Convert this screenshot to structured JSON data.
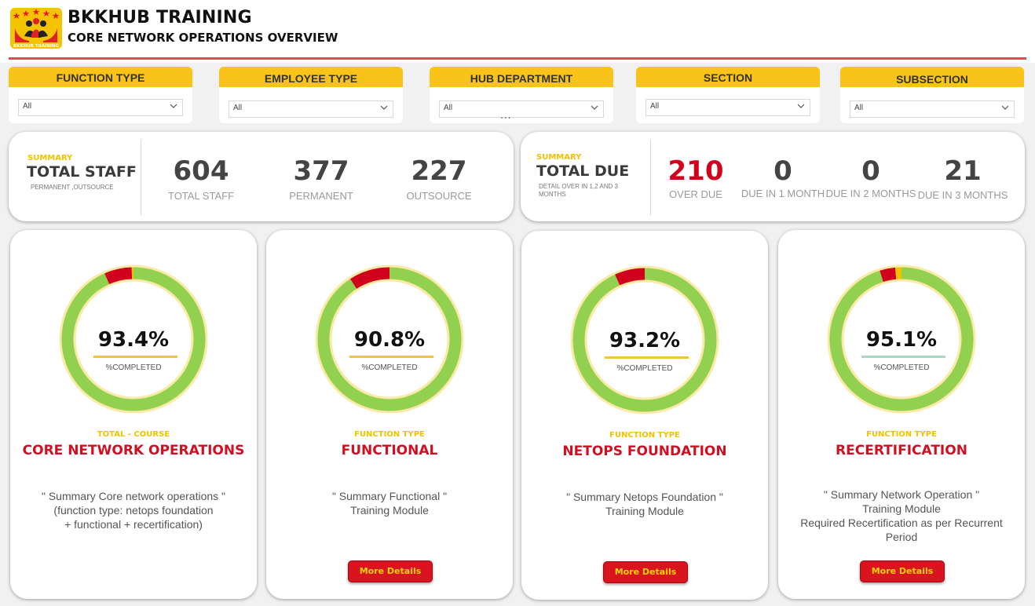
{
  "header": {
    "title": "BKKHUB TRAINING",
    "subtitle": "CORE NETWORK OPERATIONS OVERVIEW",
    "logo_caption": "BKKHUB TRAINING"
  },
  "filters": [
    {
      "label": "FUNCTION TYPE",
      "value": "All"
    },
    {
      "label": "EMPLOYEE TYPE",
      "value": "All"
    },
    {
      "label": "HUB DEPARTMENT",
      "value": "All"
    },
    {
      "label": "SECTION",
      "value": "All"
    },
    {
      "label": "SUBSECTION",
      "value": "All"
    }
  ],
  "more_options": "...",
  "staff_summary": {
    "eyebrow": "SUMMARY",
    "title": "TOTAL STAFF",
    "subtitle": "PERMANENT ,OUTSOURCE",
    "kpis": [
      {
        "value": "604",
        "label": "TOTAL STAFF"
      },
      {
        "value": "377",
        "label": "PERMANENT"
      },
      {
        "value": "227",
        "label": "OUTSOURCE"
      }
    ]
  },
  "due_summary": {
    "eyebrow": "SUMMARY",
    "title": "TOTAL DUE",
    "subtitle": "DETAIL OVER IN 1,2 AND 3 MONTHS",
    "kpis": [
      {
        "value": "210",
        "label": "OVER DUE",
        "color": "#d1001c"
      },
      {
        "value": "0",
        "label": "DUE IN 1 MONTH"
      },
      {
        "value": "0",
        "label": "DUE IN 2 MONTHS"
      },
      {
        "value": "21",
        "label": "DUE IN 3 MONTHS"
      }
    ]
  },
  "colors": {
    "accent_yellow": "#f9c31a",
    "completed_green": "#92d050",
    "overdue_red": "#d1001c",
    "warning_yellow": "#f2c200",
    "button_red": "#d9141f"
  },
  "cards": [
    {
      "percent": "93.4%",
      "caption": "%COMPLETED",
      "eyebrow": "TOTAL - COURSE",
      "name": "CORE NETWORK OPERATIONS",
      "description": "\" Summary Core network operations \"\n(function type: netops foundation\n+ functional + recertification)",
      "button": "",
      "bar_color": "#f5c23a",
      "segments": [
        {
          "fraction": 0.934,
          "color": "#92d050"
        },
        {
          "fraction": 0.062,
          "color": "#d1001c"
        },
        {
          "fraction": 0.004,
          "color": "#f2c200"
        }
      ]
    },
    {
      "percent": "90.8%",
      "caption": "%COMPLETED",
      "eyebrow": "FUNCTION TYPE",
      "name": "FUNCTIONAL",
      "description": "\" Summary Functional \"\nTraining Module",
      "button": "More Details",
      "bar_color": "#f5c23a",
      "segments": [
        {
          "fraction": 0.908,
          "color": "#92d050"
        },
        {
          "fraction": 0.092,
          "color": "#d1001c"
        }
      ]
    },
    {
      "percent": "93.2%",
      "caption": "%COMPLETED",
      "eyebrow": "FUNCTION TYPE",
      "name": "NETOPS FOUNDATION",
      "description": "\" Summary Netops Foundation \"\nTraining Module",
      "button": "More Details",
      "bar_color": "#f5c23a",
      "segments": [
        {
          "fraction": 0.932,
          "color": "#92d050"
        },
        {
          "fraction": 0.068,
          "color": "#d1001c"
        }
      ]
    },
    {
      "percent": "95.1%",
      "caption": "%COMPLETED",
      "eyebrow": "FUNCTION TYPE",
      "name": "RECERTIFICATION",
      "description": "\" Summary Network Operation \"\nTraining Module\nRequired Recertification as per Recurrent\nPeriod",
      "button": "More Details",
      "bar_color": "#a8d8c0",
      "segments": [
        {
          "fraction": 0.951,
          "color": "#92d050"
        },
        {
          "fraction": 0.035,
          "color": "#d1001c"
        },
        {
          "fraction": 0.014,
          "color": "#f2c200"
        }
      ]
    }
  ]
}
